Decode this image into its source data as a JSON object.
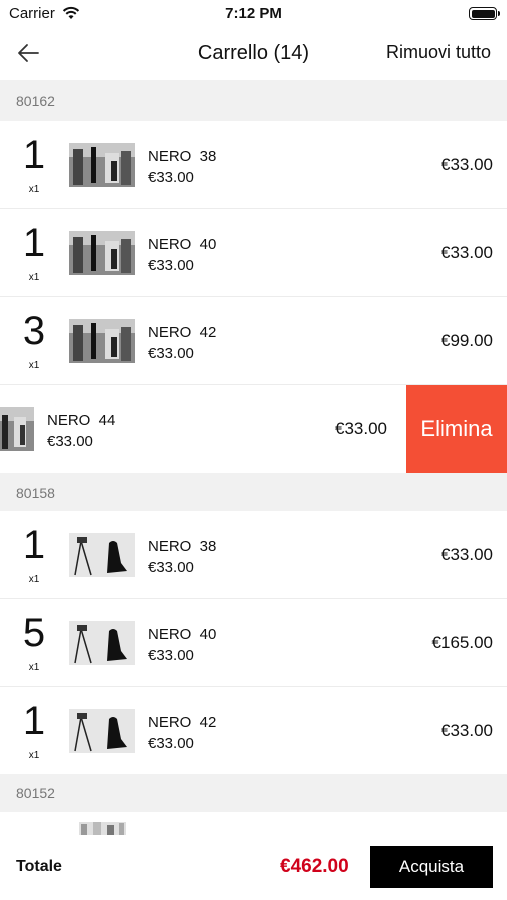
{
  "status": {
    "carrier": "Carrier",
    "time": "7:12 PM"
  },
  "nav": {
    "title": "Carrello (14)",
    "remove_all": "Rimuovi tutto"
  },
  "groups": [
    {
      "code": "80162",
      "items": [
        {
          "qty": "1",
          "qty_x": "x1",
          "name": "NERO  38",
          "unit": "€33.00",
          "total": "€33.00"
        },
        {
          "qty": "1",
          "qty_x": "x1",
          "name": "NERO  40",
          "unit": "€33.00",
          "total": "€33.00"
        },
        {
          "qty": "3",
          "qty_x": "x1",
          "name": "NERO  42",
          "unit": "€33.00",
          "total": "€99.00"
        },
        {
          "name": "NERO  44",
          "unit": "€33.00",
          "total": "€33.00",
          "action": "Elimina"
        }
      ]
    },
    {
      "code": "80158",
      "items": [
        {
          "qty": "1",
          "qty_x": "x1",
          "name": "NERO  38",
          "unit": "€33.00",
          "total": "€33.00"
        },
        {
          "qty": "5",
          "qty_x": "x1",
          "name": "NERO  40",
          "unit": "€33.00",
          "total": "€165.00"
        },
        {
          "qty": "1",
          "qty_x": "x1",
          "name": "NERO  42",
          "unit": "€33.00",
          "total": "€33.00"
        }
      ]
    },
    {
      "code": "80152",
      "items": []
    }
  ],
  "footer": {
    "total_label": "Totale",
    "total_value": "€462.00",
    "buy_label": "Acquista"
  },
  "colors": {
    "delete": "#f44f35",
    "total": "#d0021b",
    "buy": "#000000"
  },
  "icons": {
    "back": "arrow-left-icon",
    "wifi": "wifi-icon",
    "battery": "battery-icon"
  }
}
